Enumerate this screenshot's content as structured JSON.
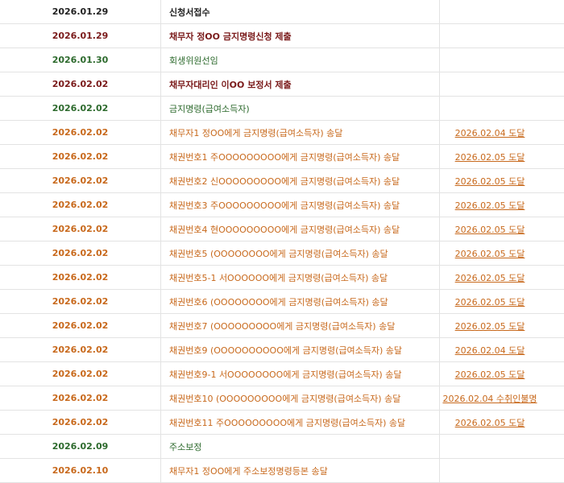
{
  "rows": [
    {
      "date": "2026.01.29",
      "content": "신청서접수",
      "result": "",
      "color": "#222222"
    },
    {
      "date": "2026.01.29",
      "content": "채무자 정OO 금지명령신청 제출",
      "result": "",
      "color": "#7a1a1a"
    },
    {
      "date": "2026.01.30",
      "content": "회생위원선임",
      "result": "",
      "color": "#2d6a2d"
    },
    {
      "date": "2026.02.02",
      "content": "채무자대리인 이OO 보정서 제출",
      "result": "",
      "color": "#7a1a1a"
    },
    {
      "date": "2026.02.02",
      "content": "금지명령(급여소득자)",
      "result": "",
      "color": "#2d6a2d"
    },
    {
      "date": "2026.02.02",
      "content": "채무자1 정OO에게 금지명령(급여소득자) 송달",
      "result": "2026.02.04 도달",
      "color": "#c8691c"
    },
    {
      "date": "2026.02.02",
      "content": "채권번호1 주OOOOOOOOO에게 금지명령(급여소득자) 송달",
      "result": "2026.02.05 도달",
      "color": "#c8691c"
    },
    {
      "date": "2026.02.02",
      "content": "채권번호2 신OOOOOOOOO에게 금지명령(급여소득자) 송달",
      "result": "2026.02.05 도달",
      "color": "#c8691c"
    },
    {
      "date": "2026.02.02",
      "content": "채권번호3 주OOOOOOOOO에게 금지명령(급여소득자) 송달",
      "result": "2026.02.05 도달",
      "color": "#c8691c"
    },
    {
      "date": "2026.02.02",
      "content": "채권번호4 현OOOOOOOOO에게 금지명령(급여소득자) 송달",
      "result": "2026.02.05 도달",
      "color": "#c8691c"
    },
    {
      "date": "2026.02.02",
      "content": "채권번호5 (OOOOOOOO에게 금지명령(급여소득자) 송달",
      "result": "2026.02.05 도달",
      "color": "#c8691c"
    },
    {
      "date": "2026.02.02",
      "content": "채권번호5-1 서OOOOOO에게 금지명령(급여소득자) 송달",
      "result": "2026.02.05 도달",
      "color": "#c8691c"
    },
    {
      "date": "2026.02.02",
      "content": "채권번호6 (OOOOOOOO에게 금지명령(급여소득자) 송달",
      "result": "2026.02.05 도달",
      "color": "#c8691c"
    },
    {
      "date": "2026.02.02",
      "content": "채권번호7 (OOOOOOOOO에게 금지명령(급여소득자) 송달",
      "result": "2026.02.05 도달",
      "color": "#c8691c"
    },
    {
      "date": "2026.02.02",
      "content": "채권번호9 (OOOOOOOOOO에게 금지명령(급여소득자) 송달",
      "result": "2026.02.04 도달",
      "color": "#c8691c"
    },
    {
      "date": "2026.02.02",
      "content": "채권번호9-1 서OOOOOOOO에게 금지명령(급여소득자) 송달",
      "result": "2026.02.05 도달",
      "color": "#c8691c"
    },
    {
      "date": "2026.02.02",
      "content": "채권번호10 (OOOOOOOOO에게 금지명령(급여소득자) 송달",
      "result": "2026.02.04 수취인불명",
      "color": "#c8691c"
    },
    {
      "date": "2026.02.02",
      "content": "채권번호11 주OOOOOOOOO에게 금지명령(급여소득자) 송달",
      "result": "2026.02.05 도달",
      "color": "#c8691c"
    },
    {
      "date": "2026.02.09",
      "content": "주소보정",
      "result": "",
      "color": "#2d6a2d"
    },
    {
      "date": "2026.02.10",
      "content": "채무자1 정OO에게 주소보정명령등본 송달",
      "result": "",
      "color": "#c8691c"
    }
  ]
}
